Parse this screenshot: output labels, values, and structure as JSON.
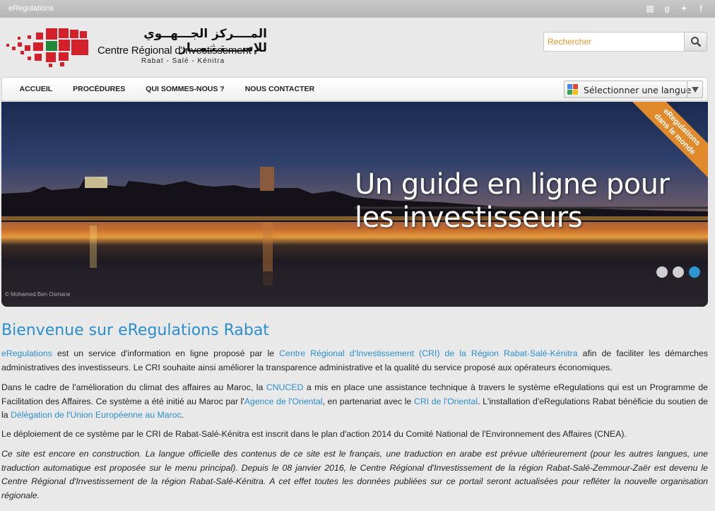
{
  "topbar": {
    "brand": "eRegulations",
    "social_icons": [
      "print-icon",
      "google-icon",
      "twitter-icon",
      "facebook-icon"
    ]
  },
  "logo": {
    "arabic": "المــــركز الجـــهــوي للإســــتـثـمــار",
    "french": "Centre Régional d'Investissement",
    "sub": "Rabat - Salé - Kénitra"
  },
  "search": {
    "placeholder": "Rechercher"
  },
  "nav": {
    "items": [
      "ACCUEIL",
      "PROCÉDURES",
      "QUI SOMMES-NOUS ?",
      "NOUS CONTACTER"
    ]
  },
  "language": {
    "label": "Sélectionner une langue"
  },
  "hero": {
    "caption_line1": "Un guide en ligne pour",
    "caption_line2": "les investisseurs",
    "ribbon_line1": "eRegulations",
    "ribbon_line2": "dans le monde",
    "credit": "© Mohamed Ben Osmane",
    "slide_count": 3,
    "active_slide": 3
  },
  "content": {
    "title": "Bienvenue sur eRegulations Rabat",
    "p1": {
      "link1": "eRegulations",
      "t1": " est un service d'information en ligne proposé par le ",
      "link2": "Centre Régional d'Investissement (CRI) de la Région Rabat-Salé-Kénitra",
      "t2": "  afin de faciliter les démarches administratives des investisseurs. Le CRI souhaite ainsi améliorer la transparence administrative et la qualité du service proposé aux opérateurs économiques."
    },
    "p2": {
      "t1": "Dans le cadre de l'amélioration du climat des affaires au Maroc, la ",
      "link1": "CNUCED",
      "t2": "  a mis en place une assistance technique à travers le système eRegulations qui est un Programme de Facilitation des Affaires.  Ce système a été initié au Maroc par l'",
      "link2": "Agence de l'Oriental",
      "t3": ", en partenariat avec le ",
      "link3": "CRI de l'Oriental",
      "t4": ". L'installation d'eRegulations Rabat bénéficie du soutien de la ",
      "link4": "Délégation de l'Union Européenne au Maroc",
      "t5": "."
    },
    "p3": "Le déploiement de ce système par le CRI de Rabat-Salé-Kénitra est inscrit dans le plan d'action 2014 du Comité National de l'Environnement des Affaires  (CNEA).",
    "p4": "Ce site est encore en construction. La langue officielle des contenus de ce site est le français, une traduction en arabe est prévue ultérieurement (pour les autres langues, une traduction automatique est proposée sur le menu principal). Depuis le 08 janvier 2016, le Centre Régional d'Investissement de la région Rabat-Salé-Zemmour-Zaër est devenu le Centre Régional d'Investissement de la région Rabat-Salé-Kénitra. A cet effet toutes les données publiées sur ce portail seront actualisées pour refléter la nouvelle organisation régionale."
  },
  "colors": {
    "accent": "#2b8ed0",
    "orange": "#e08a2c",
    "logo_red": "#d4202a",
    "logo_green": "#1e8a3a"
  }
}
